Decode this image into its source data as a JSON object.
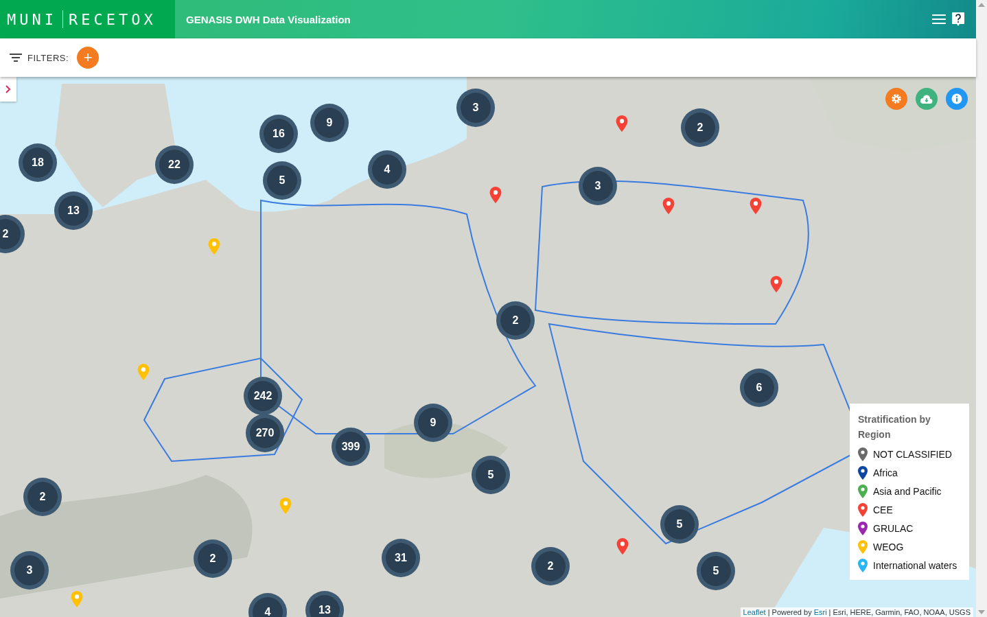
{
  "header": {
    "logo_left": "MUNI",
    "logo_right": "RECETOX",
    "title": "GENASIS DWH Data Visualization"
  },
  "filters": {
    "label": "FILTERS:",
    "add_button": "+"
  },
  "clusters": [
    "3",
    "9",
    "16",
    "2",
    "18",
    "22",
    "4",
    "5",
    "3",
    "13",
    "2",
    "2",
    "6",
    "242",
    "9",
    "270",
    "399",
    "5",
    "2",
    "5",
    "2",
    "31",
    "2",
    "3",
    "5",
    "13",
    "4"
  ],
  "markers": [
    {
      "color": "#f44336"
    },
    {
      "color": "#f44336"
    },
    {
      "color": "#f44336"
    },
    {
      "color": "#f44336"
    },
    {
      "color": "#f44336"
    },
    {
      "color": "#f44336"
    },
    {
      "color": "#ffc107"
    },
    {
      "color": "#ffc107"
    },
    {
      "color": "#ffc107"
    },
    {
      "color": "#ffc107"
    }
  ],
  "legend": {
    "title": "Stratification by Region",
    "items": [
      {
        "label": "NOT CLASSIFIED",
        "color": "#6b6b6b"
      },
      {
        "label": "Africa",
        "color": "#0d47a1"
      },
      {
        "label": "Asia and Pacific",
        "color": "#4caf50"
      },
      {
        "label": "CEE",
        "color": "#f44336"
      },
      {
        "label": "GRULAC",
        "color": "#9c27b0"
      },
      {
        "label": "WEOG",
        "color": "#ffc107"
      },
      {
        "label": "International waters",
        "color": "#29b6f6"
      }
    ]
  },
  "attribution": {
    "leaflet": "Leaflet",
    "text": "| Powered by",
    "esri": "Esri",
    "sources": "| Esri, HERE, Garmin, FAO, NOAA, USGS"
  }
}
